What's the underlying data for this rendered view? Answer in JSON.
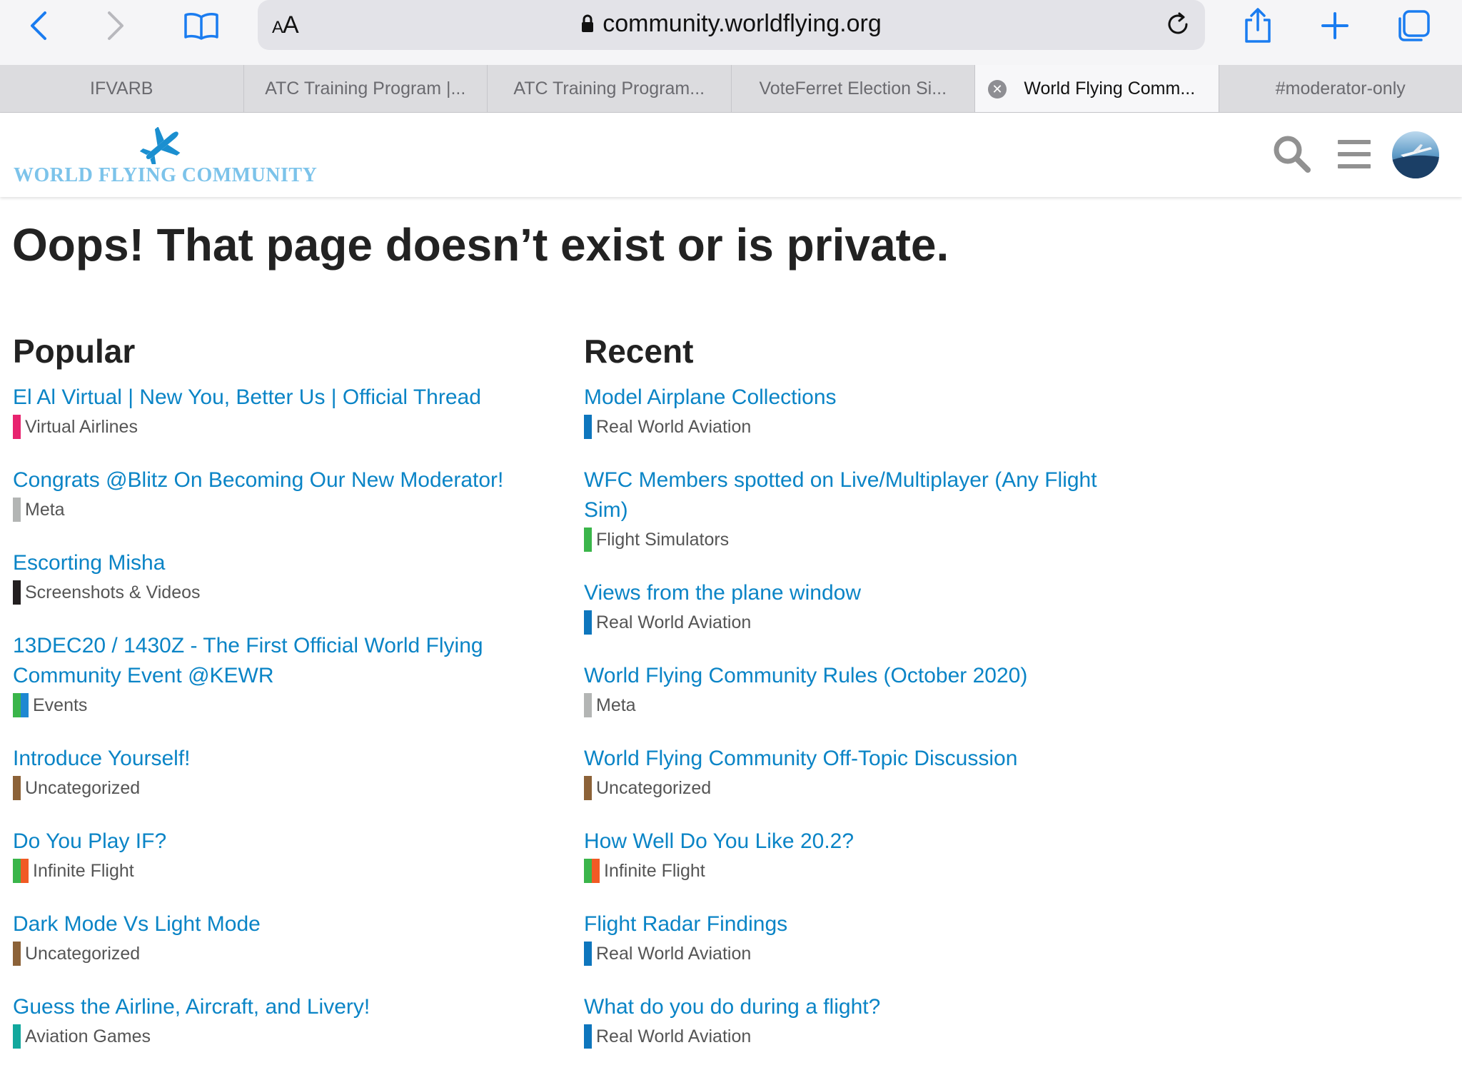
{
  "browser": {
    "text_size_label": "AA",
    "url": "community.worldflying.org",
    "tabs": [
      {
        "label": "IFVARB",
        "active": false
      },
      {
        "label": "ATC Training Program |...",
        "active": false
      },
      {
        "label": "ATC Training Program...",
        "active": false
      },
      {
        "label": "VoteFerret Election Si...",
        "active": false
      },
      {
        "label": "World Flying Comm...",
        "active": true
      },
      {
        "label": "#moderator-only",
        "active": false
      }
    ]
  },
  "site": {
    "logo_text": "WORLD FLYING COMMUNITY",
    "brand_color": "#7cc3ea",
    "link_color": "#0a84c6"
  },
  "main": {
    "error_title": "Oops! That page doesn’t exist or is private.",
    "popular": {
      "heading": "Popular",
      "items": [
        {
          "title": "El Al Virtual | New You, Better Us | Official Thread",
          "category": "Virtual Airlines",
          "colors": [
            "#e8236f"
          ]
        },
        {
          "title": "Congrats @Blitz On Becoming Our New Moderator!",
          "category": "Meta",
          "colors": [
            "#b3b5b4"
          ]
        },
        {
          "title": "Escorting Misha",
          "category": "Screenshots & Videos",
          "colors": [
            "#231f20"
          ]
        },
        {
          "title": "13DEC20 / 1430Z - The First Official World Flying Community Event @KEWR",
          "category": "Events",
          "colors": [
            "#3ab54a",
            "#1e88d2"
          ]
        },
        {
          "title": "Introduce Yourself!",
          "category": "Uncategorized",
          "colors": [
            "#8c6238"
          ]
        },
        {
          "title": "Do You Play IF?",
          "category": "Infinite Flight",
          "colors": [
            "#3ab54a",
            "#f15a24"
          ]
        },
        {
          "title": "Dark Mode Vs Light Mode",
          "category": "Uncategorized",
          "colors": [
            "#8c6238"
          ]
        },
        {
          "title": "Guess the Airline, Aircraft, and Livery!",
          "category": "Aviation Games",
          "colors": [
            "#12a89d"
          ]
        }
      ]
    },
    "recent": {
      "heading": "Recent",
      "items": [
        {
          "title": "Model Airplane Collections",
          "category": "Real World Aviation",
          "colors": [
            "#0e76bd"
          ]
        },
        {
          "title": "WFC Members spotted on Live/Multiplayer (Any Flight Sim)",
          "category": "Flight Simulators",
          "colors": [
            "#3ab54a"
          ]
        },
        {
          "title": "Views from the plane window",
          "category": "Real World Aviation",
          "colors": [
            "#0e76bd"
          ]
        },
        {
          "title": "World Flying Community Rules (October 2020)",
          "category": "Meta",
          "colors": [
            "#b3b5b4"
          ]
        },
        {
          "title": "World Flying Community Off-Topic Discussion",
          "category": "Uncategorized",
          "colors": [
            "#8c6238"
          ]
        },
        {
          "title": "How Well Do You Like 20.2?",
          "category": "Infinite Flight",
          "colors": [
            "#3ab54a",
            "#f15a24"
          ]
        },
        {
          "title": "Flight Radar Findings",
          "category": "Real World Aviation",
          "colors": [
            "#0e76bd"
          ]
        },
        {
          "title": "What do you do during a flight?",
          "category": "Real World Aviation",
          "colors": [
            "#0e76bd"
          ]
        }
      ]
    }
  }
}
